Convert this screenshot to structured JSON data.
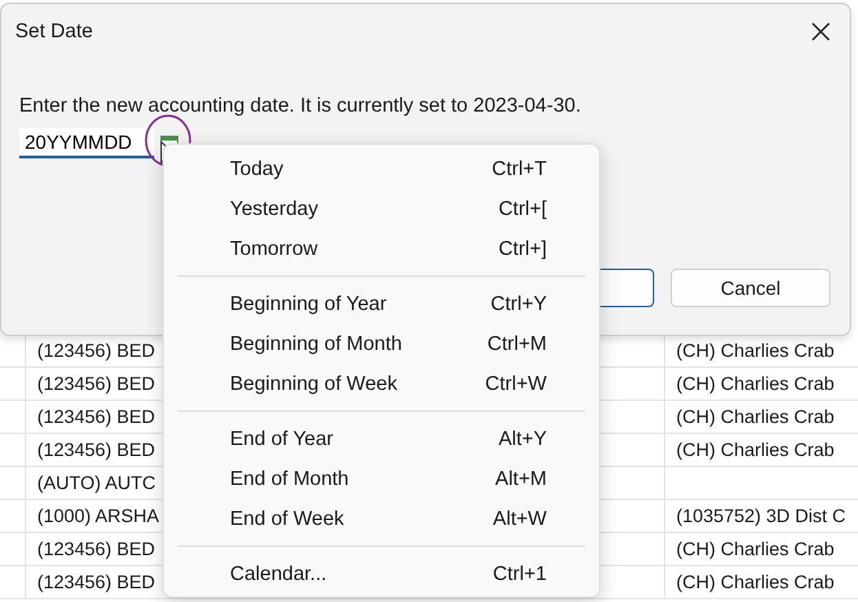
{
  "table": {
    "rows": [
      {
        "column_1": "(123456) BED",
        "column_2": "(CH) Charlies Crab"
      },
      {
        "column_1": "(123456) BED",
        "column_2": "(CH) Charlies Crab"
      },
      {
        "column_1": "(123456) BED",
        "column_2": "(CH) Charlies Crab"
      },
      {
        "column_1": "(123456) BED",
        "column_2": "(CH) Charlies Crab"
      },
      {
        "column_1": "(AUTO) AUTC",
        "column_2": ""
      },
      {
        "column_1": "(1000) ARSHA",
        "column_2": "(1035752) 3D Dist C"
      },
      {
        "column_1": "(123456) BED",
        "column_2": "(CH) Charlies Crab"
      },
      {
        "column_1": "(123456) BED",
        "column_2": "(CH) Charlies Crab"
      }
    ]
  },
  "dialog": {
    "title": "Set Date",
    "message": "Enter the new accounting date. It is currently set to 2023-04-30.",
    "date_input": {
      "value": "20YYMMDD"
    },
    "buttons": [
      {
        "label": "Cancel"
      }
    ]
  },
  "menu": [
    {
      "kind": "item",
      "label": "Today",
      "shortcut": "Ctrl+T"
    },
    {
      "kind": "item",
      "label": "Yesterday",
      "shortcut": "Ctrl+["
    },
    {
      "kind": "item",
      "label": "Tomorrow",
      "shortcut": "Ctrl+]"
    },
    {
      "kind": "separator"
    },
    {
      "kind": "item",
      "label": "Beginning of Year",
      "shortcut": "Ctrl+Y"
    },
    {
      "kind": "item",
      "label": "Beginning of Month",
      "shortcut": "Ctrl+M"
    },
    {
      "kind": "item",
      "label": "Beginning of Week",
      "shortcut": "Ctrl+W"
    },
    {
      "kind": "separator"
    },
    {
      "kind": "item",
      "label": "End of Year",
      "shortcut": "Alt+Y"
    },
    {
      "kind": "item",
      "label": "End of Month",
      "shortcut": "Alt+M"
    },
    {
      "kind": "item",
      "label": "End of Week",
      "shortcut": "Alt+W"
    },
    {
      "kind": "separator"
    },
    {
      "kind": "item",
      "label": "Calendar...",
      "shortcut": "Ctrl+1"
    }
  ]
}
